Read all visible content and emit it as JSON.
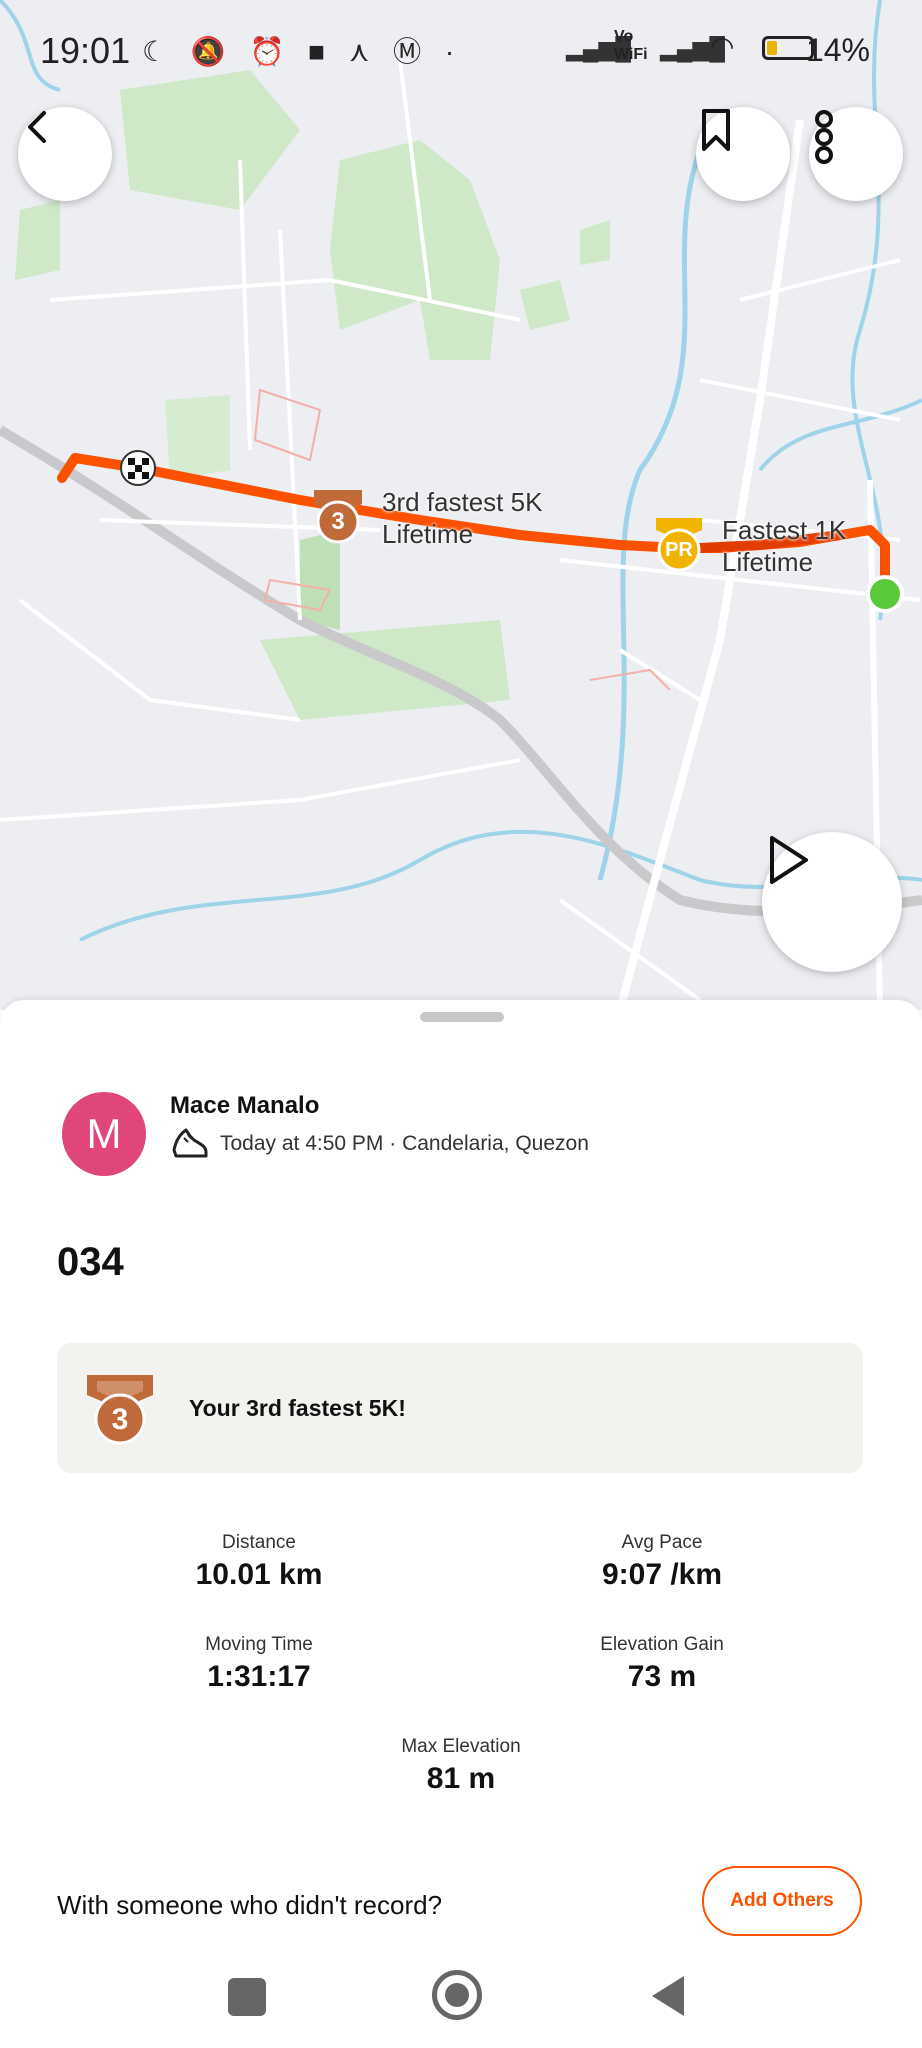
{
  "status_bar": {
    "time": "19:01",
    "battery_percent": "14%",
    "network_label_top": "Vo",
    "network_label_bottom": "WiFi"
  },
  "map": {
    "labels": {
      "segment_3rd_line1": "3rd fastest 5K",
      "segment_3rd_line2": "Lifetime",
      "segment_pr_line1": "Fastest 1K",
      "segment_pr_line2": "Lifetime"
    },
    "badges": {
      "bronze_rank": "3",
      "pr": "PR"
    },
    "route_color": "#fc5200",
    "start_color": "#5ac93a"
  },
  "activity": {
    "avatar_initial": "M",
    "athlete_name": "Mace Manalo",
    "meta": "Today at 4:50 PM · Candelaria, Quezon",
    "title": "034",
    "achievement": {
      "rank": "3",
      "text": "Your 3rd fastest 5K!"
    },
    "stats": {
      "distance_label": "Distance",
      "distance_value": "10.01 km",
      "pace_label": "Avg Pace",
      "pace_value": "9:07 /km",
      "moving_label": "Moving Time",
      "moving_value": "1:31:17",
      "elev_gain_label": "Elevation Gain",
      "elev_gain_value": "73 m",
      "max_elev_label": "Max Elevation",
      "max_elev_value": "81 m"
    },
    "prompt": "With someone who didn't record?",
    "add_others": "Add Others"
  },
  "colors": {
    "accent": "#fc5200",
    "bronze": "#c06a3a",
    "gold": "#f0b400",
    "avatar": "#e0457b"
  }
}
